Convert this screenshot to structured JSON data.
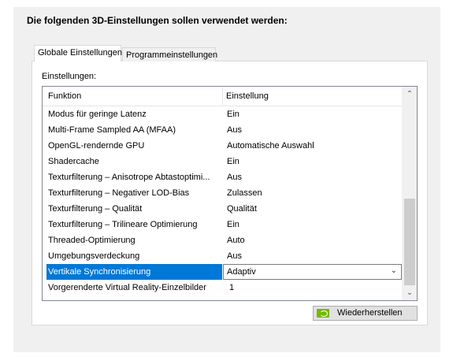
{
  "heading": "Die folgenden 3D-Einstellungen sollen verwendet werden:",
  "tabs": [
    {
      "label": "Globale Einstellungen",
      "active": true
    },
    {
      "label": "Programmeinstellungen",
      "active": false
    }
  ],
  "settings_label": "Einstellungen:",
  "table": {
    "columns": [
      "Funktion",
      "Einstellung"
    ],
    "rows": [
      {
        "function": "Modus für geringe Latenz",
        "setting": "Ein"
      },
      {
        "function": "Multi-Frame Sampled AA (MFAA)",
        "setting": "Aus"
      },
      {
        "function": "OpenGL-rendernde GPU",
        "setting": "Automatische Auswahl"
      },
      {
        "function": "Shadercache",
        "setting": "Ein"
      },
      {
        "function": "Texturfilterung – Anisotrope Abtastoptimi...",
        "setting": "Aus"
      },
      {
        "function": "Texturfilterung – Negativer LOD-Bias",
        "setting": "Zulassen"
      },
      {
        "function": "Texturfilterung – Qualität",
        "setting": "Qualität"
      },
      {
        "function": "Texturfilterung – Trilineare Optimierung",
        "setting": "Ein"
      },
      {
        "function": "Threaded-Optimierung",
        "setting": "Auto"
      },
      {
        "function": "Umgebungsverdeckung",
        "setting": "Aus"
      },
      {
        "function": "Vertikale Synchronisierung",
        "setting": "Adaptiv",
        "selected": true
      },
      {
        "function": "Vorgerenderte Virtual Reality-Einzelbilder",
        "setting": "1"
      }
    ]
  },
  "restore_button": "Wiederherstellen",
  "colors": {
    "selection": "#0078d7",
    "panel_bg": "#f0f0f0",
    "nvidia_green": "#76b900"
  }
}
